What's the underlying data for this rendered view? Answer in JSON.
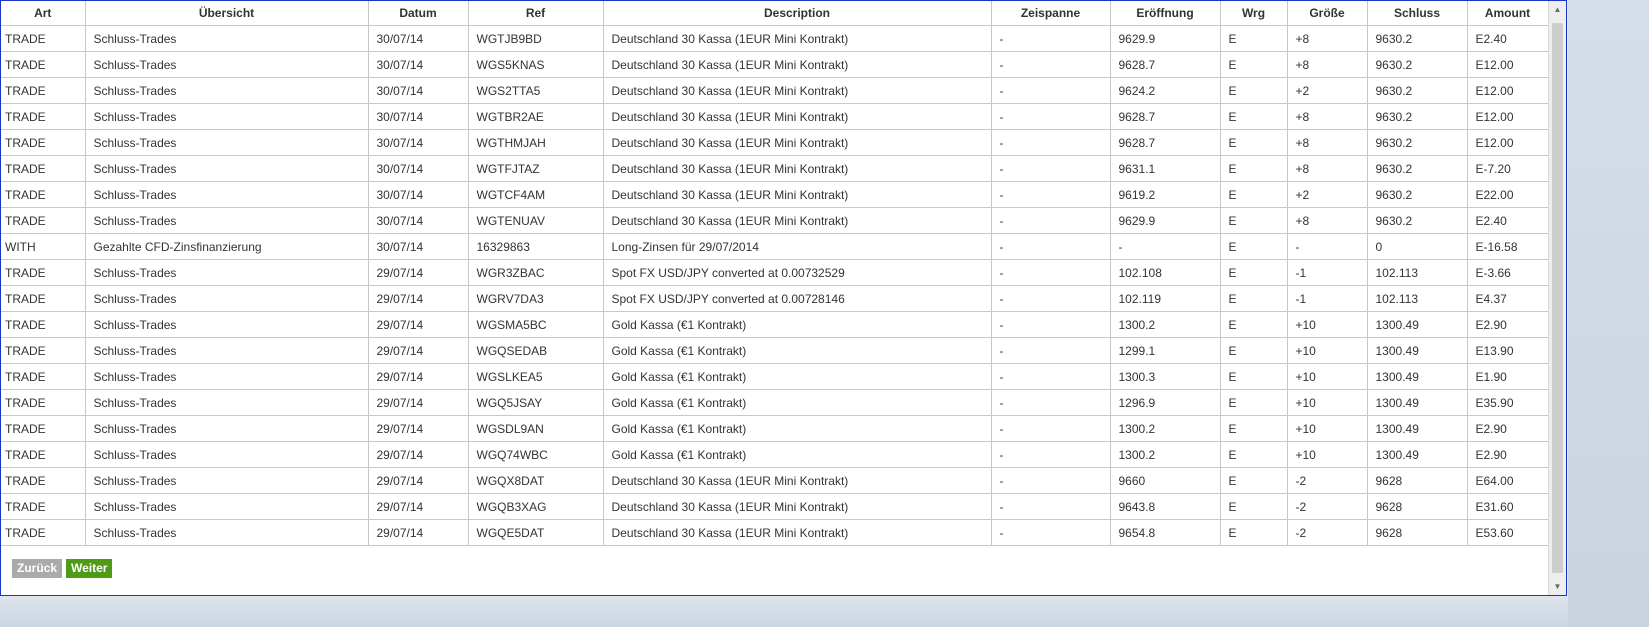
{
  "columns": [
    "Art",
    "Übersicht",
    "Datum",
    "Ref",
    "Description",
    "Zeispanne",
    "Eröffnung",
    "Wrg",
    "Größe",
    "Schluss",
    "Amount"
  ],
  "rows": [
    [
      "TRADE",
      "Schluss-Trades",
      "30/07/14",
      "WGTJB9BD",
      "Deutschland 30 Kassa (1EUR Mini Kontrakt)",
      "-",
      "9629.9",
      "E",
      "+8",
      "9630.2",
      "E2.40"
    ],
    [
      "TRADE",
      "Schluss-Trades",
      "30/07/14",
      "WGS5KNAS",
      "Deutschland 30 Kassa (1EUR Mini Kontrakt)",
      "-",
      "9628.7",
      "E",
      "+8",
      "9630.2",
      "E12.00"
    ],
    [
      "TRADE",
      "Schluss-Trades",
      "30/07/14",
      "WGS2TTA5",
      "Deutschland 30 Kassa (1EUR Mini Kontrakt)",
      "-",
      "9624.2",
      "E",
      "+2",
      "9630.2",
      "E12.00"
    ],
    [
      "TRADE",
      "Schluss-Trades",
      "30/07/14",
      "WGTBR2AE",
      "Deutschland 30 Kassa (1EUR Mini Kontrakt)",
      "-",
      "9628.7",
      "E",
      "+8",
      "9630.2",
      "E12.00"
    ],
    [
      "TRADE",
      "Schluss-Trades",
      "30/07/14",
      "WGTHMJAH",
      "Deutschland 30 Kassa (1EUR Mini Kontrakt)",
      "-",
      "9628.7",
      "E",
      "+8",
      "9630.2",
      "E12.00"
    ],
    [
      "TRADE",
      "Schluss-Trades",
      "30/07/14",
      "WGTFJTAZ",
      "Deutschland 30 Kassa (1EUR Mini Kontrakt)",
      "-",
      "9631.1",
      "E",
      "+8",
      "9630.2",
      "E-7.20"
    ],
    [
      "TRADE",
      "Schluss-Trades",
      "30/07/14",
      "WGTCF4AM",
      "Deutschland 30 Kassa (1EUR Mini Kontrakt)",
      "-",
      "9619.2",
      "E",
      "+2",
      "9630.2",
      "E22.00"
    ],
    [
      "TRADE",
      "Schluss-Trades",
      "30/07/14",
      "WGTENUAV",
      "Deutschland 30 Kassa (1EUR Mini Kontrakt)",
      "-",
      "9629.9",
      "E",
      "+8",
      "9630.2",
      "E2.40"
    ],
    [
      "WITH",
      "Gezahlte CFD-Zinsfinanzierung",
      "30/07/14",
      "16329863",
      "Long-Zinsen für 29/07/2014",
      "-",
      "-",
      "E",
      "-",
      "0",
      "E-16.58"
    ],
    [
      "TRADE",
      "Schluss-Trades",
      "29/07/14",
      "WGR3ZBAC",
      "Spot FX USD/JPY converted at 0.00732529",
      "-",
      "102.108",
      "E",
      "-1",
      "102.113",
      "E-3.66"
    ],
    [
      "TRADE",
      "Schluss-Trades",
      "29/07/14",
      "WGRV7DA3",
      "Spot FX USD/JPY converted at 0.00728146",
      "-",
      "102.119",
      "E",
      "-1",
      "102.113",
      "E4.37"
    ],
    [
      "TRADE",
      "Schluss-Trades",
      "29/07/14",
      "WGSMA5BC",
      "Gold Kassa (€1 Kontrakt)",
      "-",
      "1300.2",
      "E",
      "+10",
      "1300.49",
      "E2.90"
    ],
    [
      "TRADE",
      "Schluss-Trades",
      "29/07/14",
      "WGQSEDAB",
      "Gold Kassa (€1 Kontrakt)",
      "-",
      "1299.1",
      "E",
      "+10",
      "1300.49",
      "E13.90"
    ],
    [
      "TRADE",
      "Schluss-Trades",
      "29/07/14",
      "WGSLKEA5",
      "Gold Kassa (€1 Kontrakt)",
      "-",
      "1300.3",
      "E",
      "+10",
      "1300.49",
      "E1.90"
    ],
    [
      "TRADE",
      "Schluss-Trades",
      "29/07/14",
      "WGQ5JSAY",
      "Gold Kassa (€1 Kontrakt)",
      "-",
      "1296.9",
      "E",
      "+10",
      "1300.49",
      "E35.90"
    ],
    [
      "TRADE",
      "Schluss-Trades",
      "29/07/14",
      "WGSDL9AN",
      "Gold Kassa (€1 Kontrakt)",
      "-",
      "1300.2",
      "E",
      "+10",
      "1300.49",
      "E2.90"
    ],
    [
      "TRADE",
      "Schluss-Trades",
      "29/07/14",
      "WGQ74WBC",
      "Gold Kassa (€1 Kontrakt)",
      "-",
      "1300.2",
      "E",
      "+10",
      "1300.49",
      "E2.90"
    ],
    [
      "TRADE",
      "Schluss-Trades",
      "29/07/14",
      "WGQX8DAT",
      "Deutschland 30 Kassa (1EUR Mini Kontrakt)",
      "-",
      "9660",
      "E",
      "-2",
      "9628",
      "E64.00"
    ],
    [
      "TRADE",
      "Schluss-Trades",
      "29/07/14",
      "WGQB3XAG",
      "Deutschland 30 Kassa (1EUR Mini Kontrakt)",
      "-",
      "9643.8",
      "E",
      "-2",
      "9628",
      "E31.60"
    ],
    [
      "TRADE",
      "Schluss-Trades",
      "29/07/14",
      "WGQE5DAT",
      "Deutschland 30 Kassa (1EUR Mini Kontrakt)",
      "-",
      "9654.8",
      "E",
      "-2",
      "9628",
      "E53.60"
    ]
  ],
  "pagination": {
    "back_label": "Zurück",
    "next_label": "Weiter"
  },
  "colors": {
    "next_button": "#4f9a16",
    "back_button": "#a9aaa9",
    "window_border": "#1a33c8"
  },
  "icons": {
    "scroll_up": "scroll-up-arrow-icon",
    "scroll_down": "scroll-down-arrow-icon"
  }
}
